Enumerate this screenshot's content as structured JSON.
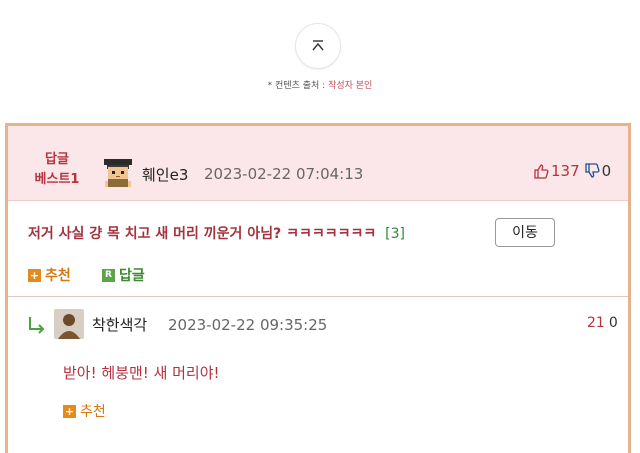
{
  "top_button": {
    "icon": "chevron-up-icon"
  },
  "source": {
    "prefix": "* 컨텐츠 출처 :",
    "author": "작성자 본인"
  },
  "best_comment": {
    "badge_line1": "답글",
    "badge_line2": "베스트1",
    "nickname": "훼인e3",
    "timestamp": "2023-02-22 07:04:13",
    "likes": "137",
    "dislikes": "0",
    "text": "저거 사실 걍 목 치고 새 머리 끼운거 아님? ㅋㅋㅋㅋㅋㅋㅋ",
    "reply_count": "[3]",
    "move_label": "이동",
    "recommend_label": "추천",
    "reply_label": "답글"
  },
  "reply": {
    "nickname": "착한색각",
    "timestamp": "2023-02-22 09:35:25",
    "likes": "21",
    "dislikes": "0",
    "text": "받아! 헤붕맨! 새 머리야!",
    "recommend_label": "추천"
  },
  "colors": {
    "accent": "#b4333f",
    "border": "#e7b38a",
    "header_bg": "#fbe7e9",
    "recommend": "#e58a1d",
    "reply": "#5aa548"
  }
}
